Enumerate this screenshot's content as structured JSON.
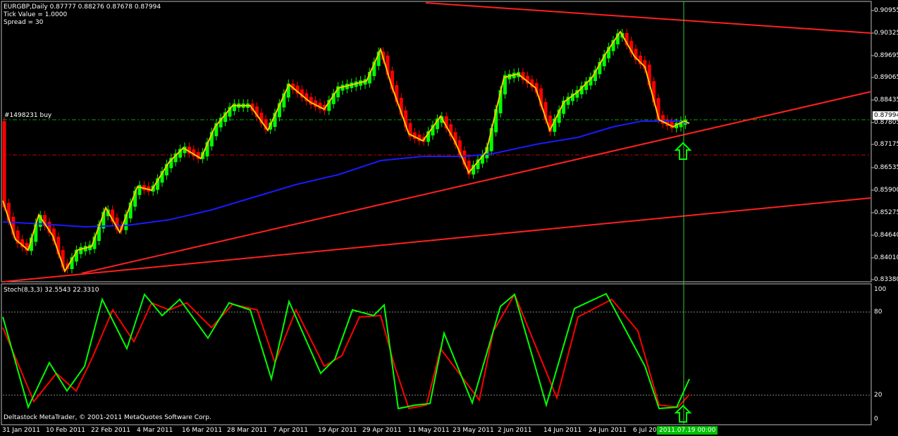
{
  "header": {
    "symbol_line": "EURGBP,Daily  0.87777 0.88276 0.87678 0.87994",
    "tick_value": "Tick Value = 1.0000",
    "spread": "Spread = 30"
  },
  "order_label": "#1498231 buy",
  "stoch_label": "Stoch(8,3,3) 32.5543 22.3310",
  "copyright": "Deltastock MetaTrader, © 2001-2011 MetaQuotes Software Corp.",
  "price_axis": [
    "0.90955",
    "0.90325",
    "0.89695",
    "0.89065",
    "0.88435",
    "0.87805",
    "0.87175",
    "0.86535",
    "0.85900",
    "0.85275",
    "0.84640",
    "0.84010",
    "0.83380"
  ],
  "current_price": "0.87994",
  "stoch_axis": [
    "100",
    "80",
    "20",
    "0"
  ],
  "date_axis": [
    "31 Jan 2011",
    "10 Feb 2011",
    "22 Feb 2011",
    "4 Mar 2011",
    "16 Mar 2011",
    "28 Mar 2011",
    "7 Apr 2011",
    "19 Apr 2011",
    "29 Apr 2011",
    "11 May 2011",
    "23 May 2011",
    "2 Jun 2011",
    "14 Jun 2011",
    "24 Jun 2011",
    "6 Jul 20"
  ],
  "crosshair_time": "2011.07.19 00:00",
  "colors": {
    "bull": "#00ff00",
    "bear": "#ff0000",
    "ma_fast": "#ffc800",
    "ma_slow": "#1a1aff",
    "trendline": "#ff2020",
    "crosshair": "#33cc33",
    "stoch_main": "#00ff00",
    "stoch_signal": "#ff0000"
  },
  "icons": [
    "buy-arrow-icon",
    "stoch-buy-arrow-icon"
  ]
}
